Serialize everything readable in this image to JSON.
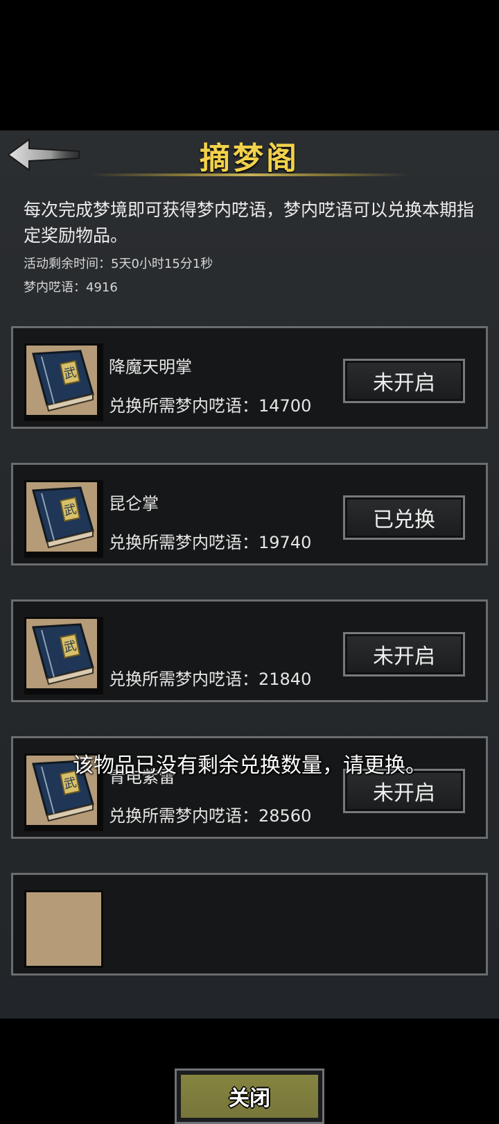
{
  "header": {
    "title": "摘梦阁",
    "back_icon": "arrow-left-icon"
  },
  "description": "每次完成梦境即可获得梦内呓语，梦内呓语可以兑换本期指定奖励物品。",
  "activity_time": "活动剩余时间：5天0小时15分1秒",
  "currency": "梦内呓语：4916",
  "items": [
    {
      "name": "降魔天明掌",
      "cost": "兑换所需梦内呓语：14700",
      "status": "未开启",
      "icon": "martial-book-icon"
    },
    {
      "name": "昆仑掌",
      "cost": "兑换所需梦内呓语：19740",
      "status": "已兑换",
      "icon": "martial-book-icon"
    },
    {
      "name": "",
      "cost": "兑换所需梦内呓语：21840",
      "status": "未开启",
      "icon": "martial-book-icon"
    },
    {
      "name": "青电紫雷",
      "cost": "兑换所需梦内呓语：28560",
      "status": "未开启",
      "icon": "martial-book-icon"
    }
  ],
  "toast": "该物品已没有剩余兑换数量，请更换。",
  "close_label": "关闭"
}
